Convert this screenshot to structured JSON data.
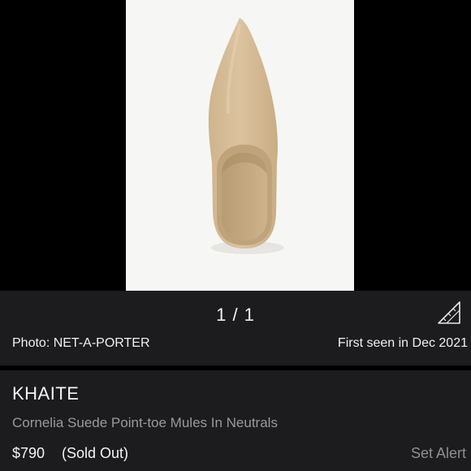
{
  "gallery": {
    "counter": "1 / 1",
    "photo_credit": "Photo: NET-A-PORTER",
    "first_seen": "First seen in Dec 2021",
    "size_guide_icon": "ruler-triangle-icon"
  },
  "product": {
    "brand": "KHAITE",
    "name": "Cornelia Suede Point-toe Mules In Neutrals",
    "price": "$790",
    "status": "(Sold Out)",
    "alert_label": "Set Alert"
  },
  "colors": {
    "background": "#000000",
    "panel": "#1c1c1e",
    "photo_background": "#f6f6f5",
    "suede": "#d8bf99",
    "muted_text": "#9a9a9e"
  }
}
